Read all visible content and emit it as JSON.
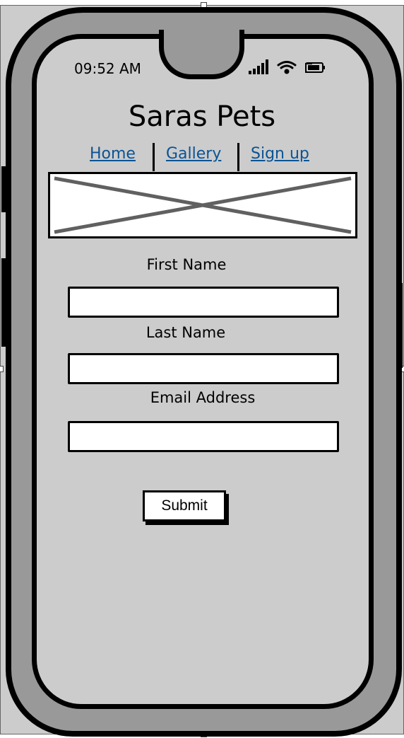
{
  "status_bar": {
    "time": "09:52 AM",
    "icons": [
      "signal-icon",
      "wifi-icon",
      "battery-icon"
    ]
  },
  "header": {
    "title": "Saras Pets"
  },
  "nav": {
    "links": [
      {
        "label": "Home"
      },
      {
        "label": "Gallery"
      },
      {
        "label": "Sign up"
      }
    ],
    "link_color": "#0b5394"
  },
  "form": {
    "first_name_label": "First Name",
    "first_name_value": "",
    "last_name_label": "Last Name",
    "last_name_value": "",
    "email_label": "Email Address",
    "email_value": "",
    "submit_label": "Submit"
  }
}
